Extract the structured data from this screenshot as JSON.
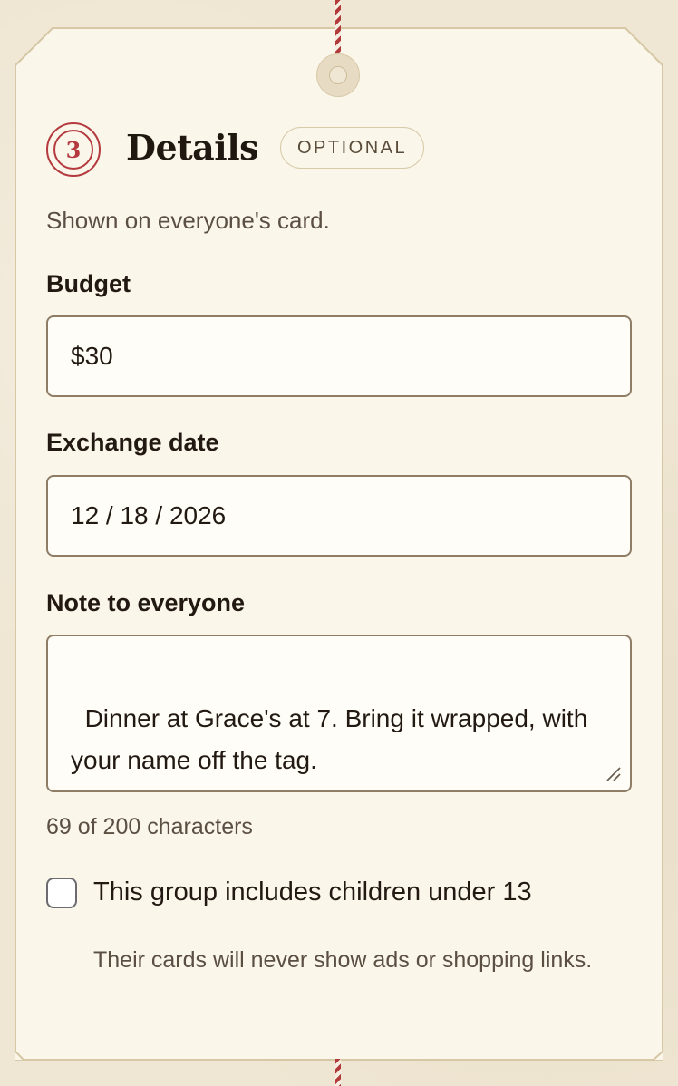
{
  "section": {
    "step_number": "3",
    "title": "Details",
    "badge": "OPTIONAL",
    "subtitle": "Shown on everyone's card."
  },
  "budget": {
    "label": "Budget",
    "value": "$30"
  },
  "exchange_date": {
    "label": "Exchange date",
    "value": "12 / 18 / 2026"
  },
  "note": {
    "label": "Note to everyone",
    "value": "Dinner at Grace's at 7. Bring it wrapped, with your name off the tag.",
    "counter": "69 of 200 characters"
  },
  "children": {
    "checkbox_label": "This group includes children under 13",
    "checked": false,
    "hint": "Their cards will never show ads or shopping links."
  },
  "colors": {
    "accent": "#b43a3f",
    "tag_bg": "#faf6ea",
    "page_bg": "#efe6d3"
  }
}
